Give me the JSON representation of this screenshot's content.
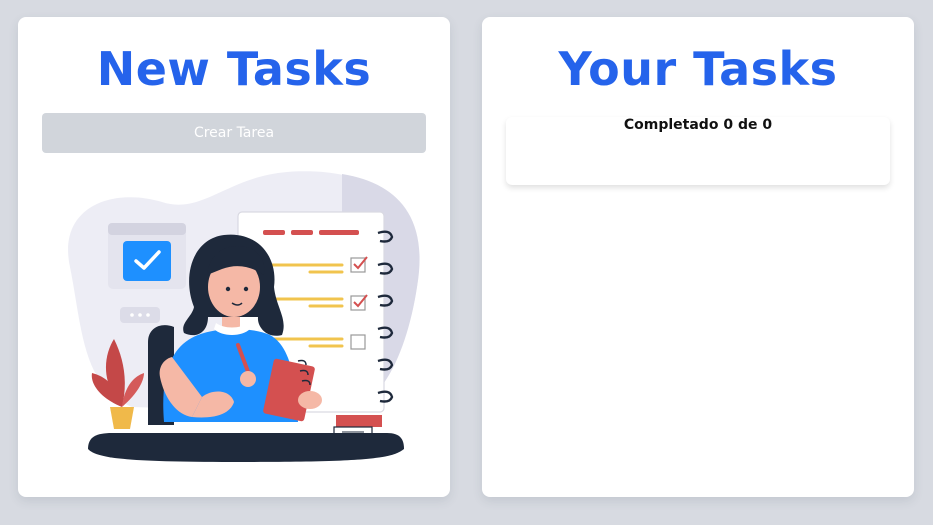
{
  "new_tasks": {
    "title": "New Tasks",
    "create_button_label": "Crear Tarea"
  },
  "your_tasks": {
    "title": "Your Tasks",
    "completed_label": "Completado",
    "completed_count": "0",
    "of_label": "de",
    "total_count": "0"
  },
  "colors": {
    "accent": "#2563eb",
    "background": "#d7dae1",
    "card": "#ffffff",
    "button_disabled": "#d1d5db"
  },
  "icons": {
    "illustration": "woman-checklist-illustration",
    "check": "check-icon"
  }
}
